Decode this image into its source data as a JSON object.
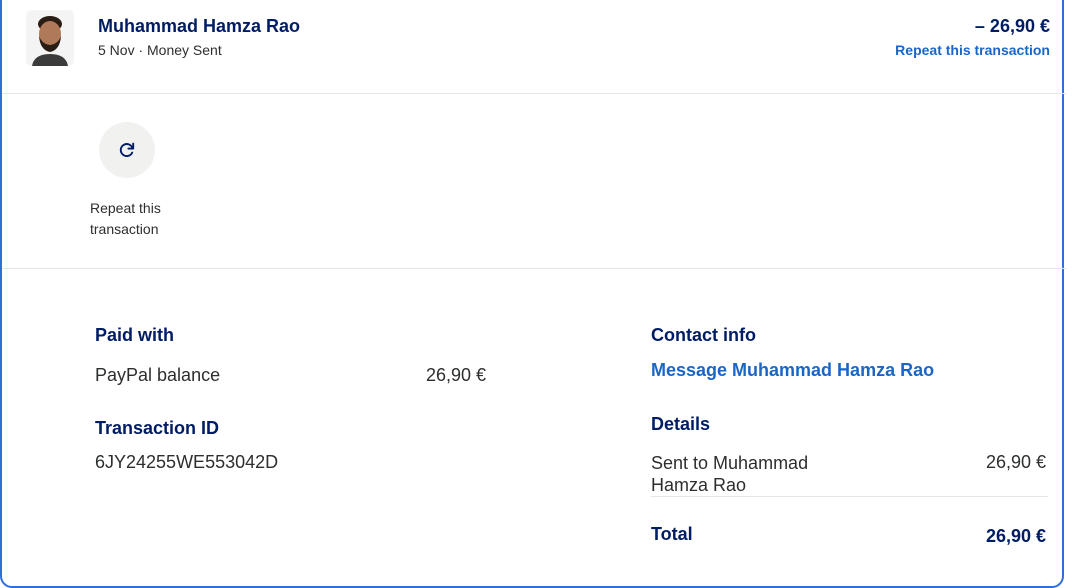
{
  "header": {
    "name": "Muhammad Hamza Rao",
    "meta": "5 Nov · Money Sent",
    "amount": "– 26,90 €",
    "repeat_link": "Repeat this transaction"
  },
  "actions": {
    "repeat_icon": "refresh-icon",
    "repeat_label": "Repeat this transaction"
  },
  "paid_with": {
    "title": "Paid with",
    "method": "PayPal balance",
    "amount": "26,90 €"
  },
  "transaction": {
    "title": "Transaction ID",
    "id": "6JY24255WE553042D"
  },
  "contact": {
    "title": "Contact info",
    "message_link": "Message Muhammad Hamza Rao"
  },
  "details": {
    "title": "Details",
    "sent_to": "Sent to Muhammad Hamza Rao",
    "sent_amount": "26,90 €",
    "total_label": "Total",
    "total_amount": "26,90 €"
  },
  "colors": {
    "accent": "#1a66c7",
    "frame_border": "#2f6fd8",
    "heading": "#001c64"
  }
}
